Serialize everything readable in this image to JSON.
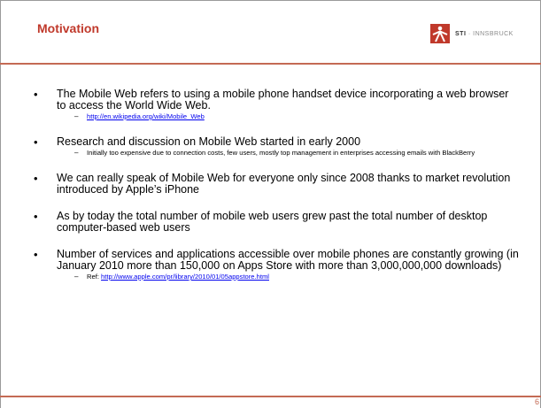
{
  "header": {
    "title": "Motivation",
    "logo_text_brand": "STI",
    "logo_text_city": "INNSBRUCK"
  },
  "bullets": [
    {
      "text": "The Mobile Web refers to using a mobile phone handset device incorporating a web browser to access the World Wide Web.",
      "sub": {
        "prefix": "",
        "link": "http://en.wikipedia.org/wiki/Mobile_Web",
        "text": ""
      }
    },
    {
      "text": "Research and discussion on Mobile Web started in early 2000",
      "sub": {
        "prefix": "",
        "link": "",
        "text": "Initially too expensive due to connection costs, few users, mostly top management in enterprises accessing emails with BlackBerry"
      }
    },
    {
      "text": "We can really speak of Mobile Web for everyone only since 2008 thanks to market revolution introduced by Apple’s iPhone"
    },
    {
      "text": "As by today the total number of mobile web users grew past the total number of desktop computer-based web users"
    },
    {
      "text": "Number of services and applications accessible over mobile phones are constantly growing (in January 2010 more than 150,000 on Apps Store with more than 3,000,000,000 downloads)",
      "sub": {
        "prefix": "Ref: ",
        "link": "http://www.apple.com/pr/library/2010/01/05appstore.html",
        "text": ""
      }
    }
  ],
  "footer": {
    "page_number": "6"
  },
  "colors": {
    "title": "#c0392b",
    "rule": "#c46a54",
    "link": "#0000ee"
  }
}
